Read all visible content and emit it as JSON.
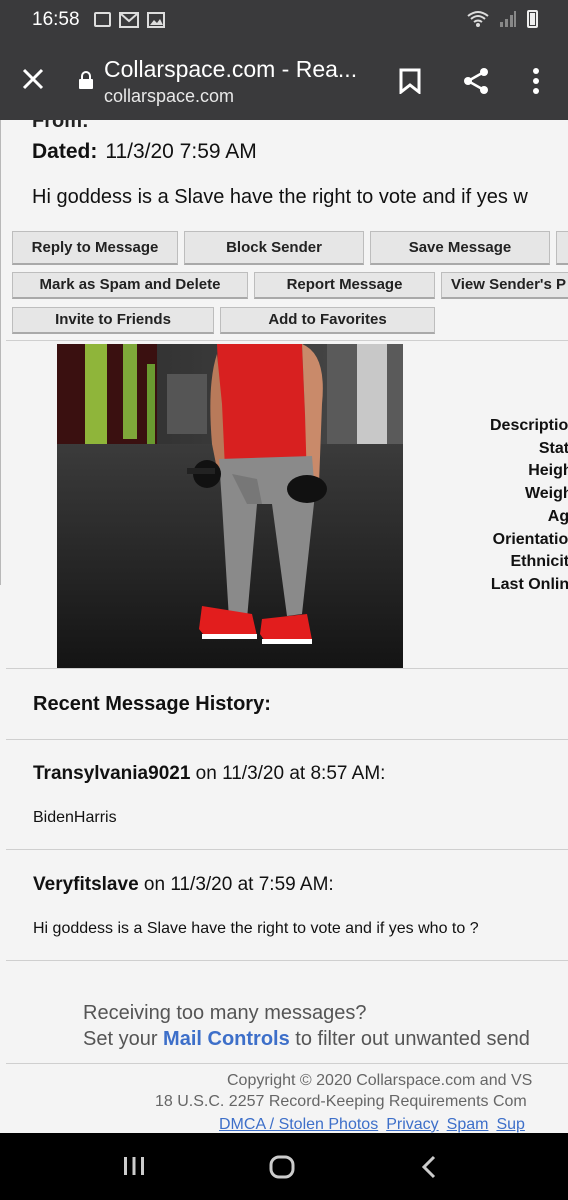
{
  "status_bar": {
    "time": "16:58",
    "icons": [
      "calendar-icon",
      "gmail-icon",
      "image-icon"
    ],
    "right_icons": [
      "wifi-icon",
      "signal-icon",
      "battery-icon"
    ]
  },
  "browser": {
    "title": "Collarspace.com - Rea...",
    "url": "collarspace.com",
    "icons": [
      "close-icon",
      "lock-icon",
      "bookmark-icon",
      "share-icon",
      "more-vert-icon"
    ]
  },
  "message": {
    "cut_label": "From:",
    "dated_label": "Dated:",
    "dated_value": "11/3/20 7:59 AM",
    "body": "Hi goddess is a Slave have the right to vote and if yes w"
  },
  "actions": {
    "reply": "Reply to Message",
    "block": "Block Sender",
    "save": "Save Message",
    "spam_delete": "Mark as Spam and Delete",
    "report": "Report Message",
    "view_profile": "View Sender's P",
    "invite": "Invite to Friends",
    "favorites": "Add to Favorites"
  },
  "profile": {
    "labels": [
      "Description",
      "State",
      "Height",
      "Weight",
      "Age",
      "Orientation",
      "Ethnicity",
      "Last Online"
    ]
  },
  "history": {
    "title": "Recent Message History:",
    "entries": [
      {
        "sender": "Transylvania9021",
        "meta": " on 11/3/20 at 8:57 AM:",
        "body": "BidenHarris"
      },
      {
        "sender": "Veryfitslave",
        "meta": " on 11/3/20 at 7:59 AM:",
        "body": "Hi goddess is a Slave have the right to vote and if yes who to ?"
      }
    ]
  },
  "mail_controls": {
    "line1": "Receiving too many messages?",
    "line2_prefix": "Set your ",
    "link": "Mail Controls",
    "line2_suffix": " to filter out unwanted send"
  },
  "footer": {
    "copyright": "Copyright © 2020 Collarspace.com and VS",
    "legal": "18 U.S.C. 2257 Record-Keeping Requirements Com",
    "links": [
      "DMCA / Stolen Photos",
      "Privacy",
      "Spam",
      "Sup"
    ]
  },
  "nav_bar": {
    "icons": [
      "recent-apps-icon",
      "home-icon",
      "back-icon"
    ]
  },
  "colors": {
    "chrome": "#3a3a3c",
    "link": "#3d6fc9",
    "page_bg": "#f4f4f4"
  }
}
